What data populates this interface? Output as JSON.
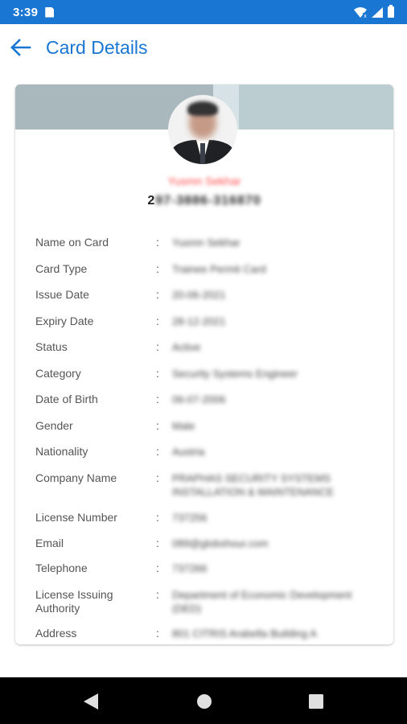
{
  "status_bar": {
    "time": "3:39"
  },
  "app_bar": {
    "title": "Card Details"
  },
  "card": {
    "holder_name": "Yusmn Sekhar",
    "card_number_first": "2",
    "card_number_rest": "97-3886-316870",
    "fields": [
      {
        "label": "Name on Card",
        "value": "Yusmn Sekhar"
      },
      {
        "label": "Card Type",
        "value": "Trainee Permit Card"
      },
      {
        "label": "Issue Date",
        "value": "20-06-2021"
      },
      {
        "label": "Expiry Date",
        "value": "28-12-2021"
      },
      {
        "label": "Status",
        "value": "Active"
      },
      {
        "label": "Category",
        "value": "Security Systems Engineer"
      },
      {
        "label": "Date of Birth",
        "value": "06-07-2006"
      },
      {
        "label": "Gender",
        "value": "Male"
      },
      {
        "label": "Nationality",
        "value": "Austria"
      },
      {
        "label": "Company Name",
        "value": "PRAPHAS SECURITY SYSTEMS INSTALLATION & MAINTENANCE"
      },
      {
        "label": "License Number",
        "value": "737256"
      },
      {
        "label": "Email",
        "value": "089@globshour.com"
      },
      {
        "label": "Telephone",
        "value": "737266"
      },
      {
        "label": "License Issuing Authority",
        "value": "Department of Economic Development (DED)"
      },
      {
        "label": "Address",
        "value": "801 CITRIS Arabella Building A"
      }
    ]
  }
}
